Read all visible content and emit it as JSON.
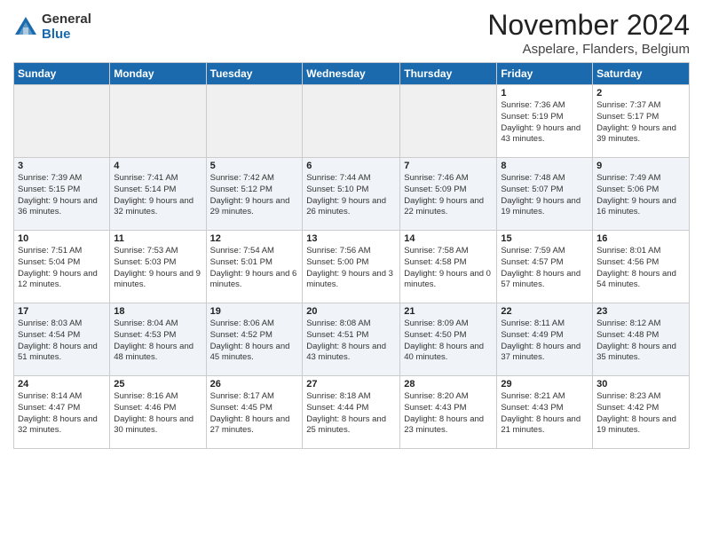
{
  "header": {
    "logo_general": "General",
    "logo_blue": "Blue",
    "title": "November 2024",
    "location": "Aspelare, Flanders, Belgium"
  },
  "days_of_week": [
    "Sunday",
    "Monday",
    "Tuesday",
    "Wednesday",
    "Thursday",
    "Friday",
    "Saturday"
  ],
  "weeks": [
    [
      {
        "day": "",
        "info": ""
      },
      {
        "day": "",
        "info": ""
      },
      {
        "day": "",
        "info": ""
      },
      {
        "day": "",
        "info": ""
      },
      {
        "day": "",
        "info": ""
      },
      {
        "day": "1",
        "info": "Sunrise: 7:36 AM\nSunset: 5:19 PM\nDaylight: 9 hours and 43 minutes."
      },
      {
        "day": "2",
        "info": "Sunrise: 7:37 AM\nSunset: 5:17 PM\nDaylight: 9 hours and 39 minutes."
      }
    ],
    [
      {
        "day": "3",
        "info": "Sunrise: 7:39 AM\nSunset: 5:15 PM\nDaylight: 9 hours and 36 minutes."
      },
      {
        "day": "4",
        "info": "Sunrise: 7:41 AM\nSunset: 5:14 PM\nDaylight: 9 hours and 32 minutes."
      },
      {
        "day": "5",
        "info": "Sunrise: 7:42 AM\nSunset: 5:12 PM\nDaylight: 9 hours and 29 minutes."
      },
      {
        "day": "6",
        "info": "Sunrise: 7:44 AM\nSunset: 5:10 PM\nDaylight: 9 hours and 26 minutes."
      },
      {
        "day": "7",
        "info": "Sunrise: 7:46 AM\nSunset: 5:09 PM\nDaylight: 9 hours and 22 minutes."
      },
      {
        "day": "8",
        "info": "Sunrise: 7:48 AM\nSunset: 5:07 PM\nDaylight: 9 hours and 19 minutes."
      },
      {
        "day": "9",
        "info": "Sunrise: 7:49 AM\nSunset: 5:06 PM\nDaylight: 9 hours and 16 minutes."
      }
    ],
    [
      {
        "day": "10",
        "info": "Sunrise: 7:51 AM\nSunset: 5:04 PM\nDaylight: 9 hours and 12 minutes."
      },
      {
        "day": "11",
        "info": "Sunrise: 7:53 AM\nSunset: 5:03 PM\nDaylight: 9 hours and 9 minutes."
      },
      {
        "day": "12",
        "info": "Sunrise: 7:54 AM\nSunset: 5:01 PM\nDaylight: 9 hours and 6 minutes."
      },
      {
        "day": "13",
        "info": "Sunrise: 7:56 AM\nSunset: 5:00 PM\nDaylight: 9 hours and 3 minutes."
      },
      {
        "day": "14",
        "info": "Sunrise: 7:58 AM\nSunset: 4:58 PM\nDaylight: 9 hours and 0 minutes."
      },
      {
        "day": "15",
        "info": "Sunrise: 7:59 AM\nSunset: 4:57 PM\nDaylight: 8 hours and 57 minutes."
      },
      {
        "day": "16",
        "info": "Sunrise: 8:01 AM\nSunset: 4:56 PM\nDaylight: 8 hours and 54 minutes."
      }
    ],
    [
      {
        "day": "17",
        "info": "Sunrise: 8:03 AM\nSunset: 4:54 PM\nDaylight: 8 hours and 51 minutes."
      },
      {
        "day": "18",
        "info": "Sunrise: 8:04 AM\nSunset: 4:53 PM\nDaylight: 8 hours and 48 minutes."
      },
      {
        "day": "19",
        "info": "Sunrise: 8:06 AM\nSunset: 4:52 PM\nDaylight: 8 hours and 45 minutes."
      },
      {
        "day": "20",
        "info": "Sunrise: 8:08 AM\nSunset: 4:51 PM\nDaylight: 8 hours and 43 minutes."
      },
      {
        "day": "21",
        "info": "Sunrise: 8:09 AM\nSunset: 4:50 PM\nDaylight: 8 hours and 40 minutes."
      },
      {
        "day": "22",
        "info": "Sunrise: 8:11 AM\nSunset: 4:49 PM\nDaylight: 8 hours and 37 minutes."
      },
      {
        "day": "23",
        "info": "Sunrise: 8:12 AM\nSunset: 4:48 PM\nDaylight: 8 hours and 35 minutes."
      }
    ],
    [
      {
        "day": "24",
        "info": "Sunrise: 8:14 AM\nSunset: 4:47 PM\nDaylight: 8 hours and 32 minutes."
      },
      {
        "day": "25",
        "info": "Sunrise: 8:16 AM\nSunset: 4:46 PM\nDaylight: 8 hours and 30 minutes."
      },
      {
        "day": "26",
        "info": "Sunrise: 8:17 AM\nSunset: 4:45 PM\nDaylight: 8 hours and 27 minutes."
      },
      {
        "day": "27",
        "info": "Sunrise: 8:18 AM\nSunset: 4:44 PM\nDaylight: 8 hours and 25 minutes."
      },
      {
        "day": "28",
        "info": "Sunrise: 8:20 AM\nSunset: 4:43 PM\nDaylight: 8 hours and 23 minutes."
      },
      {
        "day": "29",
        "info": "Sunrise: 8:21 AM\nSunset: 4:43 PM\nDaylight: 8 hours and 21 minutes."
      },
      {
        "day": "30",
        "info": "Sunrise: 8:23 AM\nSunset: 4:42 PM\nDaylight: 8 hours and 19 minutes."
      }
    ]
  ]
}
